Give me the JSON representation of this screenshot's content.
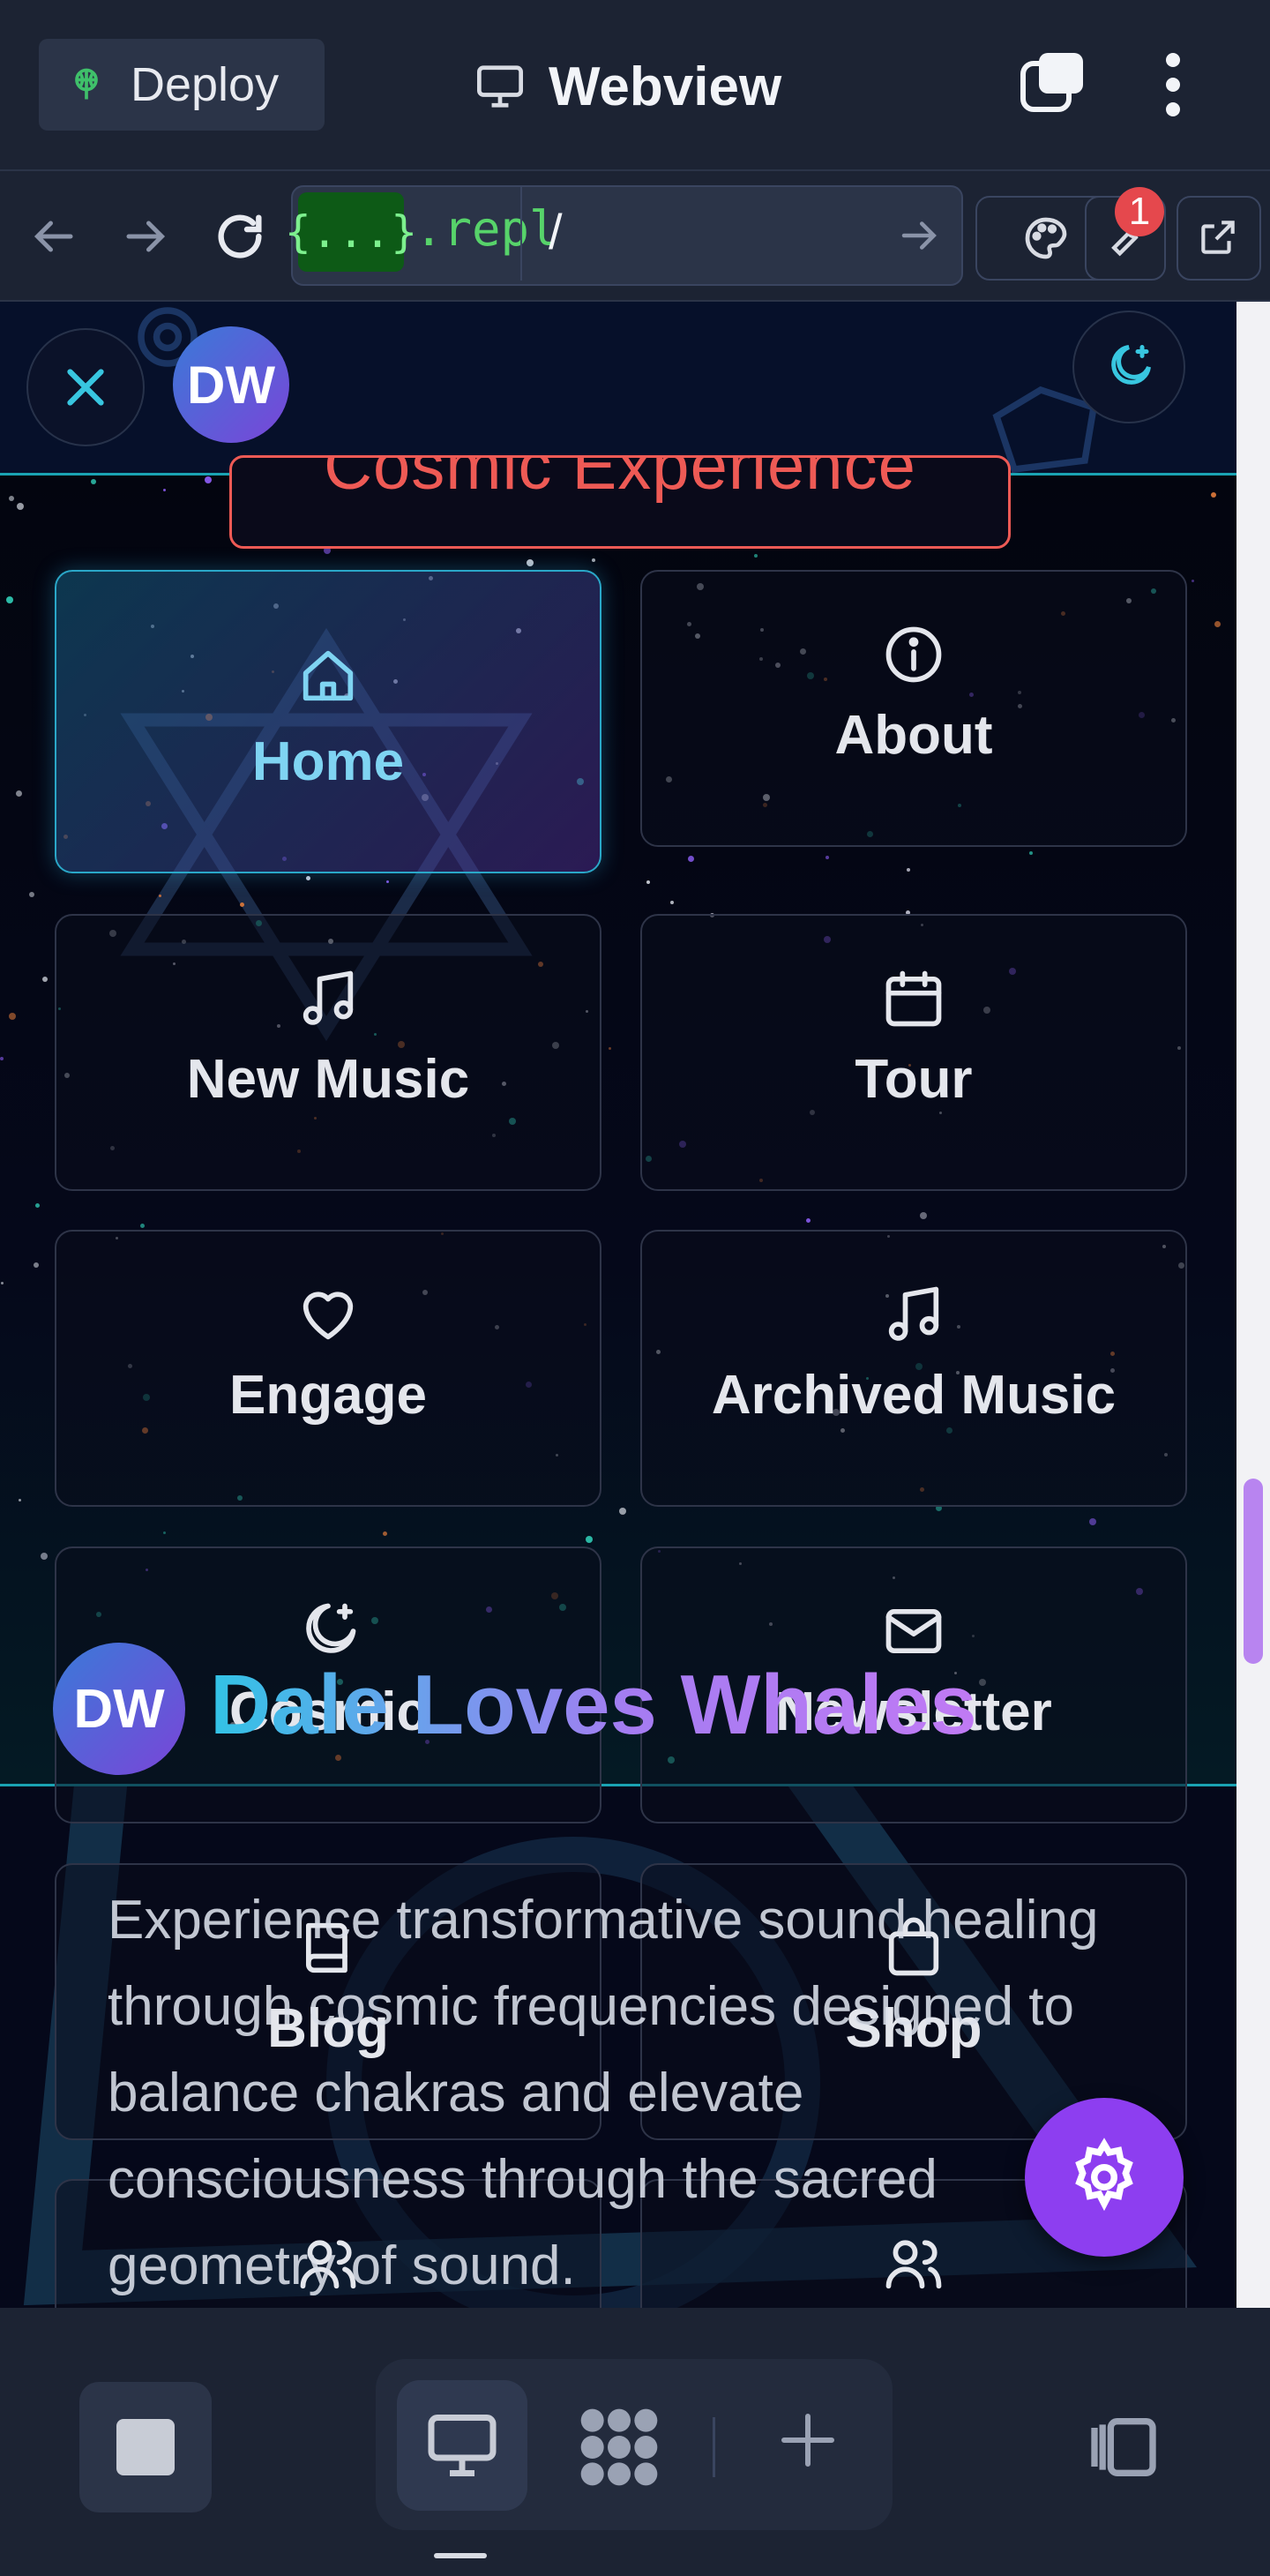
{
  "topbar": {
    "deploy_label": "Deploy",
    "title": "Webview",
    "icons": [
      "deploy-icon",
      "monitor-icon",
      "tabs-icon",
      "kebab-menu-icon"
    ]
  },
  "addressbar": {
    "chip": "{...}",
    "domain": ".repl",
    "path": "/",
    "badge_count": "1",
    "icons": [
      "back-arrow-icon",
      "forward-arrow-icon",
      "reload-icon",
      "go-arrow-icon",
      "palette-icon",
      "wrench-icon",
      "external-link-icon"
    ]
  },
  "site": {
    "avatar_initials": "DW",
    "banner_text": "Cosmic Experience",
    "menu": [
      {
        "label": "Home",
        "icon": "home-icon",
        "active": true
      },
      {
        "label": "About",
        "icon": "info-icon"
      },
      {
        "label": "New Music",
        "icon": "music-note-icon"
      },
      {
        "label": "Tour",
        "icon": "calendar-icon"
      },
      {
        "label": "Engage",
        "icon": "heart-icon"
      },
      {
        "label": "Archived Music",
        "icon": "music-note-icon"
      },
      {
        "label": "Cosmic",
        "icon": "moon-star-icon"
      },
      {
        "label": "Newsletter",
        "icon": "mail-icon"
      },
      {
        "label": "Blog",
        "icon": "book-icon"
      },
      {
        "label": "Shop",
        "icon": "bag-icon"
      },
      {
        "label": "",
        "icon": "users-icon"
      },
      {
        "label": "",
        "icon": "users-icon"
      }
    ],
    "hero": {
      "title": "Dale Loves Whales",
      "description": "Experience transformative sound healing through cosmic frequencies designed to balance chakras and elevate consciousness through the sacred geometry of sound."
    }
  },
  "colors": {
    "accent_teal": "#1aa3b3",
    "accent_purple": "#8d3ef0",
    "banner_red": "#ee5a55",
    "badge_red": "#e5484d",
    "url_green": "#57d36a"
  },
  "bottombar": {
    "icons": [
      "stop-icon",
      "desktop-icon",
      "grid-dots-icon",
      "plus-icon",
      "side-panel-icon"
    ]
  }
}
